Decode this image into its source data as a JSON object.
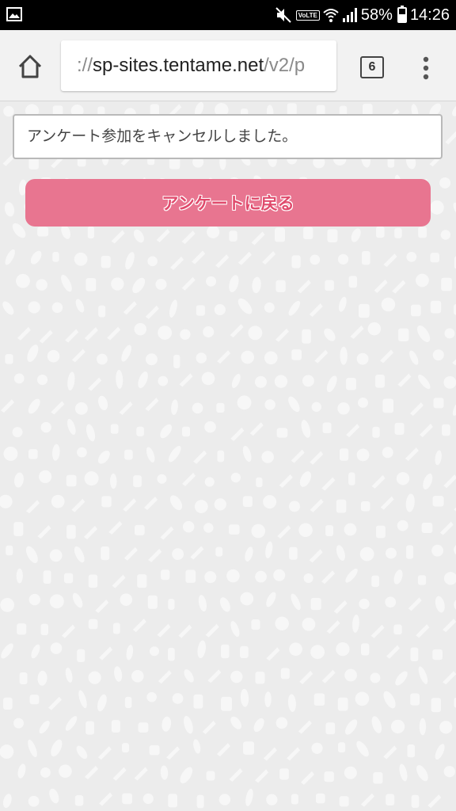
{
  "status_bar": {
    "battery": "58%",
    "battery_level": 0.58,
    "time": "14:26",
    "volte": "VoLTE",
    "icons": [
      "gallery-icon",
      "mute-icon",
      "volte-icon",
      "wifi-icon",
      "signal-icon",
      "battery-icon"
    ]
  },
  "toolbar": {
    "url_prefix": "://",
    "url_host": "sp-sites.tentame.net",
    "url_path": "/v2/p",
    "tab_count": "6",
    "icons": [
      "home-icon",
      "tabs-icon",
      "more-vert-icon"
    ]
  },
  "main": {
    "message": "アンケート参加をキャンセルしました。",
    "back_button_label": "アンケートに戻る"
  },
  "colors": {
    "button_bg": "#e87590",
    "button_text": "#e04a6c",
    "background": "#ececec"
  }
}
